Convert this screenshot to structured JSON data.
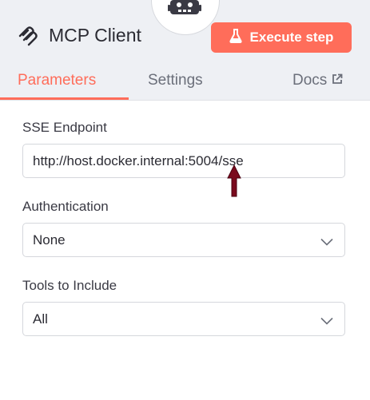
{
  "header": {
    "title": "MCP Client",
    "execute_button": "Execute step"
  },
  "tabs": [
    {
      "label": "Parameters",
      "active": true
    },
    {
      "label": "Settings",
      "active": false
    },
    {
      "label": "Docs",
      "active": false
    }
  ],
  "params": {
    "sse_endpoint": {
      "label": "SSE Endpoint",
      "value": "http://host.docker.internal:5004/sse"
    },
    "authentication": {
      "label": "Authentication",
      "value": "None"
    },
    "tools_to_include": {
      "label": "Tools to Include",
      "value": "All"
    }
  },
  "icons": {
    "node": "robot-icon",
    "title": "mcp-logo-icon",
    "execute": "flask-icon",
    "docs": "external-link-icon",
    "dropdown": "chevron-down-icon"
  },
  "colors": {
    "accent": "#ff6d5a",
    "header_bg": "#eef0f4",
    "cursor": "#7a0a1e"
  }
}
